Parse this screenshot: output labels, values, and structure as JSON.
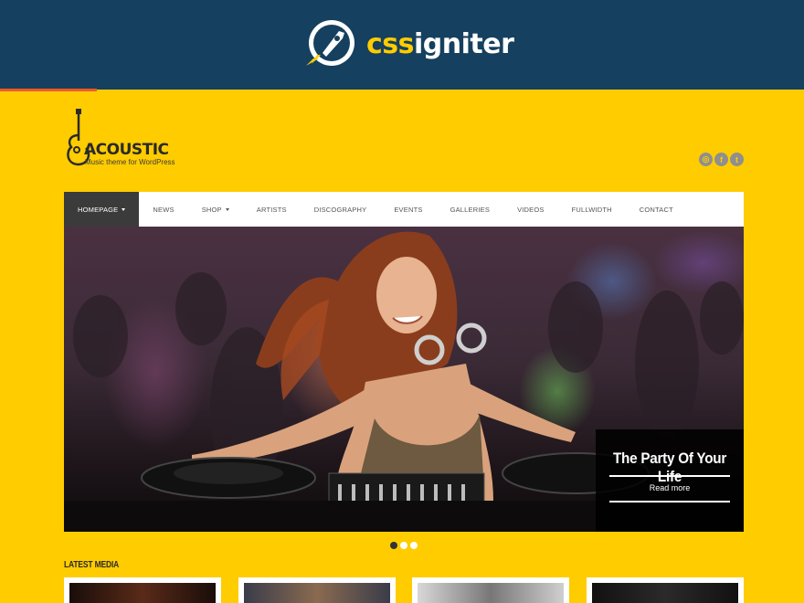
{
  "banner": {
    "brand_prefix": "css",
    "brand_suffix": "igniter",
    "logo_icon": "rocket-icon",
    "bg_color": "#15405f",
    "accent_color": "#ffcc00"
  },
  "site": {
    "name": "ACOUSTIC",
    "tagline": "Music theme for WordPress",
    "logo_icon": "guitar-icon",
    "bg_color": "#ffcc00"
  },
  "socials": [
    {
      "icon": "dribbble-icon",
      "glyph": "◎"
    },
    {
      "icon": "facebook-icon",
      "glyph": "f"
    },
    {
      "icon": "twitter-icon",
      "glyph": "t"
    }
  ],
  "nav": {
    "items": [
      {
        "label": "HOMEPAGE",
        "active": true,
        "dropdown": true
      },
      {
        "label": "NEWS"
      },
      {
        "label": "SHOP",
        "dropdown": true
      },
      {
        "label": "ARTISTS"
      },
      {
        "label": "DISCOGRAPHY"
      },
      {
        "label": "EVENTS"
      },
      {
        "label": "GALLERIES"
      },
      {
        "label": "VIDEOS"
      },
      {
        "label": "FULLWIDTH"
      },
      {
        "label": "CONTACT"
      }
    ]
  },
  "slider": {
    "caption_title": "The Party Of Your Life",
    "caption_link": "Read more",
    "slide_count": 3,
    "active_slide": 1
  },
  "latest_media": {
    "title": "LATEST MEDIA"
  }
}
